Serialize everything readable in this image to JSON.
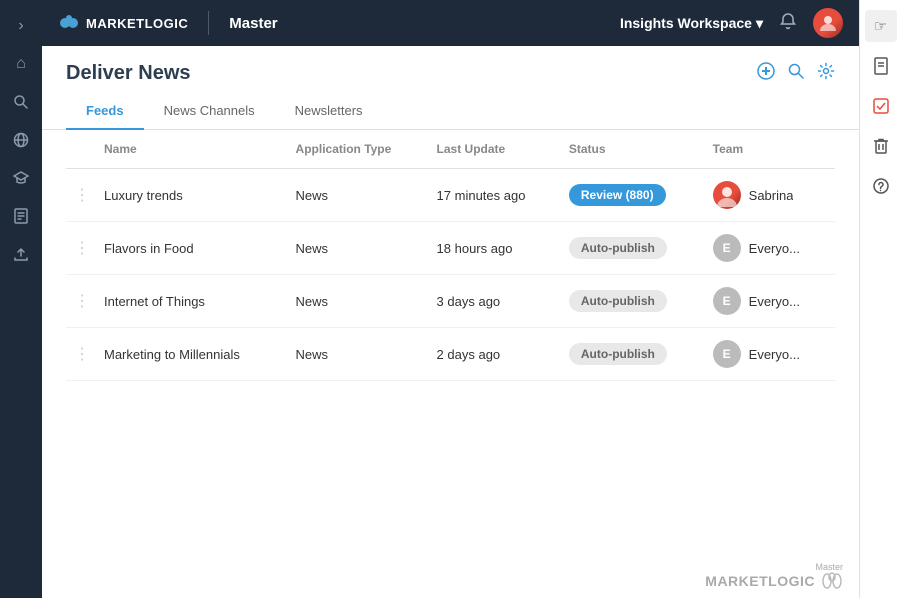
{
  "brand": {
    "logo_text": "MARKETLOGIC",
    "divider": "|",
    "master": "Master"
  },
  "topnav": {
    "workspace_label": "Insights Workspace",
    "workspace_arrow": "▾",
    "bell_icon": "🔔"
  },
  "page": {
    "title": "Deliver News"
  },
  "tabs": [
    {
      "label": "Feeds",
      "active": true
    },
    {
      "label": "News Channels",
      "active": false
    },
    {
      "label": "Newsletters",
      "active": false
    }
  ],
  "table": {
    "columns": [
      "",
      "Name",
      "Application Type",
      "Last Update",
      "Status",
      "Team"
    ],
    "rows": [
      {
        "name": "Luxury trends",
        "app_type": "News",
        "last_update": "17 minutes ago",
        "status": "Review (880)",
        "status_type": "review",
        "team_name": "Sabrina",
        "team_avatar_type": "img"
      },
      {
        "name": "Flavors in Food",
        "app_type": "News",
        "last_update": "18 hours ago",
        "status": "Auto-publish",
        "status_type": "autopublish",
        "team_name": "Everyo...",
        "team_avatar_type": "e"
      },
      {
        "name": "Internet of Things",
        "app_type": "News",
        "last_update": "3 days ago",
        "status": "Auto-publish",
        "status_type": "autopublish",
        "team_name": "Everyo...",
        "team_avatar_type": "e"
      },
      {
        "name": "Marketing to Millennials",
        "app_type": "News",
        "last_update": "2 days ago",
        "status": "Auto-publish",
        "status_type": "autopublish",
        "team_name": "Everyo...",
        "team_avatar_type": "e"
      }
    ]
  },
  "bottom_brand": {
    "sub": "Master",
    "name": "MARKETLOGIC"
  },
  "sidebar_left": {
    "icons": [
      {
        "name": "chevron-right-icon",
        "symbol": "›"
      },
      {
        "name": "home-icon",
        "symbol": "⌂"
      },
      {
        "name": "search-icon",
        "symbol": "🔍"
      },
      {
        "name": "globe-icon",
        "symbol": "🌐"
      },
      {
        "name": "graduation-icon",
        "symbol": "🎓"
      },
      {
        "name": "document-icon",
        "symbol": "📄"
      },
      {
        "name": "upload-icon",
        "symbol": "⬆"
      }
    ]
  },
  "sidebar_right": {
    "icons": [
      {
        "name": "cursor-icon",
        "symbol": "☞",
        "highlight": true
      },
      {
        "name": "bookmark-icon",
        "symbol": "📚"
      },
      {
        "name": "checklist-icon",
        "symbol": "📋",
        "active": true
      },
      {
        "name": "trash-icon",
        "symbol": "🗑"
      },
      {
        "name": "help-icon",
        "symbol": "❓"
      }
    ]
  }
}
